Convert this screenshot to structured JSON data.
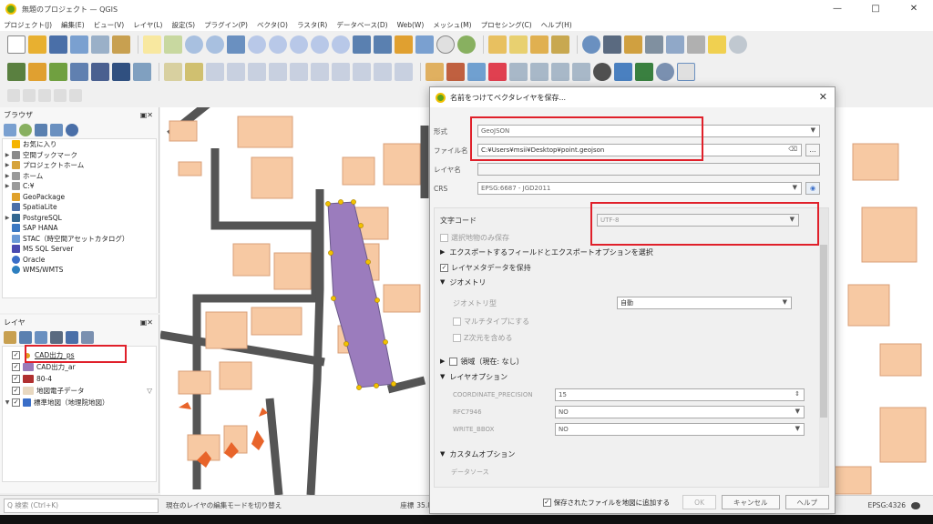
{
  "window": {
    "title": "無題のプロジェクト — QGIS",
    "minimize": "—",
    "maximize": "□",
    "close": "✕"
  },
  "menu": [
    "プロジェクト(J)",
    "編集(E)",
    "ビュー(V)",
    "レイヤ(L)",
    "設定(S)",
    "プラグイン(P)",
    "ベクタ(O)",
    "ラスタ(R)",
    "データベース(D)",
    "Web(W)",
    "メッシュ(M)",
    "プロセシング(C)",
    "ヘルプ(H)"
  ],
  "browser": {
    "title": "ブラウザ",
    "items": [
      {
        "label": "お気に入り",
        "arrow": "",
        "icon_color": "#f5b400"
      },
      {
        "label": "空間ブックマーク",
        "arrow": "▶",
        "icon_color": "#8a8a8a"
      },
      {
        "label": "プロジェクトホーム",
        "arrow": "▶",
        "icon_color": "#d6a33a"
      },
      {
        "label": "ホーム",
        "arrow": "▶",
        "icon_color": "#9a9a9a"
      },
      {
        "label": "C:¥",
        "arrow": "▶",
        "icon_color": "#9a9a9a"
      },
      {
        "label": "GeoPackage",
        "arrow": "",
        "icon_color": "#e0a12a"
      },
      {
        "label": "SpatiaLite",
        "arrow": "",
        "icon_color": "#4c6fa8"
      },
      {
        "label": "PostgreSQL",
        "arrow": "▶",
        "icon_color": "#336791"
      },
      {
        "label": "SAP HANA",
        "arrow": "",
        "icon_color": "#3a78c2"
      },
      {
        "label": "STAC（時空間アセットカタログ）",
        "arrow": "",
        "icon_color": "#6a9ad6"
      },
      {
        "label": "MS SQL Server",
        "arrow": "",
        "icon_color": "#4a4ab0"
      },
      {
        "label": "Oracle",
        "arrow": "",
        "icon_color": "#3a6ec8"
      },
      {
        "label": "WMS/WMTS",
        "arrow": "",
        "icon_color": "#2d7fbf"
      }
    ]
  },
  "layers": {
    "title": "レイヤ",
    "items": [
      {
        "label": "CAD出力_ps",
        "checked": "✓",
        "icon_color": "#e0a020",
        "underline": true
      },
      {
        "label": "CAD出力_ar",
        "checked": "✓",
        "icon_color": "#9a7ab8",
        "underline": false
      },
      {
        "label": "80-4",
        "checked": "✓",
        "icon_color": "#b03030",
        "underline": false
      },
      {
        "label": "地図電子データ",
        "checked": "✓",
        "icon_color": "#e8d8c0",
        "underline": false
      },
      {
        "label": "標準地図（地理院地図）",
        "checked": "✓",
        "icon_color": "#3a6ec8",
        "underline": false
      }
    ]
  },
  "status": {
    "search_placeholder": "Q 検索 (Ctrl+K)",
    "hint": "現在のレイヤの編集モードを切り替え",
    "coord_label": "座標",
    "coord_value": "35.87",
    "crs": "EPSG:4326"
  },
  "dialog": {
    "title": "名前をつけてベクタレイヤを保存...",
    "close": "✕",
    "format_label": "形式",
    "format_value": "GeoJSON",
    "file_label": "ファイル名",
    "file_value": "C:¥Users¥msii¥Desktop¥point.geojson",
    "browse": "…",
    "layername_label": "レイヤ名",
    "crs_label": "CRS",
    "crs_value": "EPSG:6687 - JGD2011",
    "encoding_label": "文字コード",
    "encoding_value": "UTF-8",
    "selected_only": "選択地物のみ保存",
    "export_fields": "エクスポートするフィールドとエクスポートオプションを選択",
    "keep_metadata": "レイヤメタデータを保持",
    "geometry_group": "ジオメトリ",
    "geometry_type_label": "ジオメトリ型",
    "geometry_type_value": "自動",
    "multitype": "マルチタイプにする",
    "include_z": "Z次元を含める",
    "extent": "領域（現在: なし）",
    "layer_options": "レイヤオプション",
    "opt_coord_precision_label": "COORDINATE_PRECISION",
    "opt_coord_precision_value": "15",
    "opt_rfc_label": "RFC7946",
    "opt_rfc_value": "NO",
    "opt_bbox_label": "WRITE_BBOX",
    "opt_bbox_value": "NO",
    "custom_options": "カスタムオプション",
    "data_source": "データソース",
    "add_to_map": "保存されたファイルを地図に追加する",
    "ok": "OK",
    "cancel": "キャンセル",
    "help": "ヘルプ"
  }
}
